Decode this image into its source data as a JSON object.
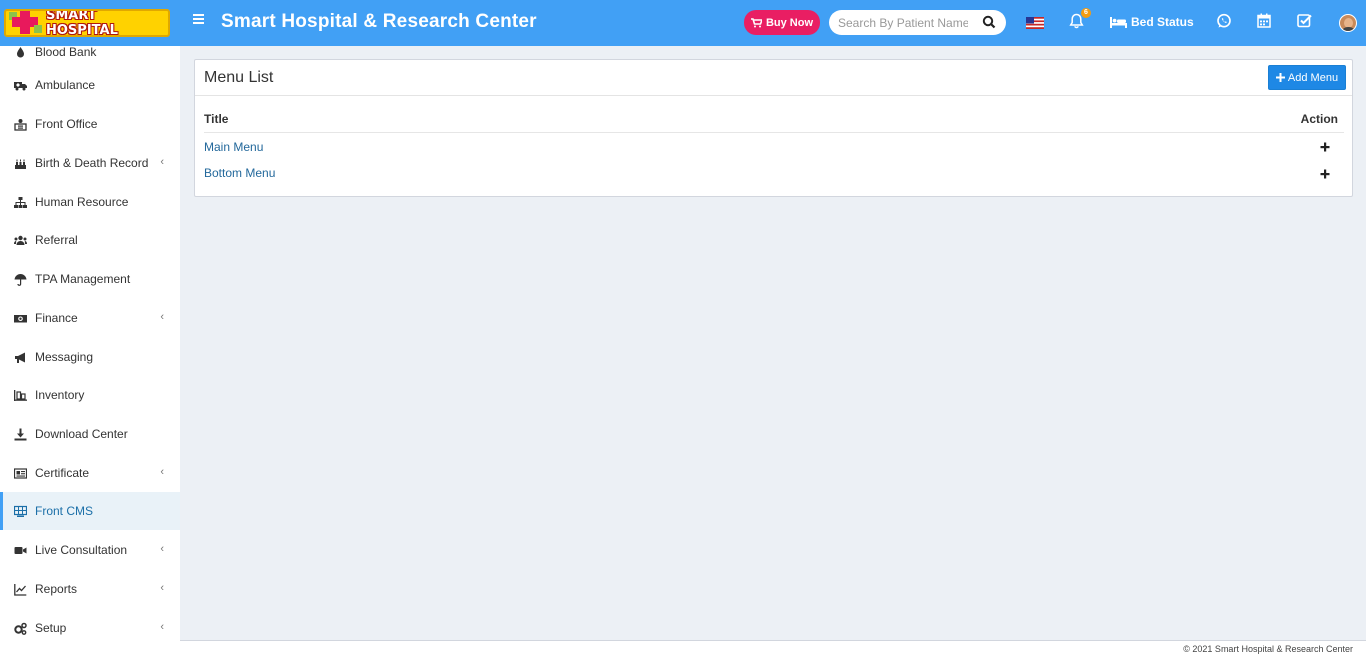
{
  "header": {
    "logo_text": "SMART HOSPITAL",
    "app_title": "Smart Hospital & Research Center",
    "buy_now_label": "Buy Now",
    "search_placeholder": "Search By Patient Name",
    "notification_count": "6",
    "bed_status_label": "Bed Status"
  },
  "sidebar": {
    "items": [
      {
        "label": "Blood Bank",
        "icon": "blood-drop-icon",
        "has_submenu": false
      },
      {
        "label": "Ambulance",
        "icon": "ambulance-icon",
        "has_submenu": false
      },
      {
        "label": "Front Office",
        "icon": "front-office-icon",
        "has_submenu": false
      },
      {
        "label": "Birth & Death Record",
        "icon": "birth-death-icon",
        "has_submenu": true
      },
      {
        "label": "Human Resource",
        "icon": "sitemap-icon",
        "has_submenu": false
      },
      {
        "label": "Referral",
        "icon": "users-icon",
        "has_submenu": false
      },
      {
        "label": "TPA Management",
        "icon": "umbrella-icon",
        "has_submenu": false
      },
      {
        "label": "Finance",
        "icon": "money-icon",
        "has_submenu": true
      },
      {
        "label": "Messaging",
        "icon": "bullhorn-icon",
        "has_submenu": false
      },
      {
        "label": "Inventory",
        "icon": "inventory-icon",
        "has_submenu": false
      },
      {
        "label": "Download Center",
        "icon": "download-icon",
        "has_submenu": false
      },
      {
        "label": "Certificate",
        "icon": "certificate-icon",
        "has_submenu": true
      },
      {
        "label": "Front CMS",
        "icon": "cms-icon",
        "has_submenu": false,
        "active": true
      },
      {
        "label": "Live Consultation",
        "icon": "video-icon",
        "has_submenu": true
      },
      {
        "label": "Reports",
        "icon": "line-chart-icon",
        "has_submenu": true
      },
      {
        "label": "Setup",
        "icon": "gears-icon",
        "has_submenu": true
      }
    ]
  },
  "main": {
    "box_title": "Menu List",
    "add_button_label": "Add Menu",
    "columns": {
      "title": "Title",
      "action": "Action"
    },
    "rows": [
      {
        "title": "Main Menu"
      },
      {
        "title": "Bottom Menu"
      }
    ]
  },
  "footer": {
    "copyright": "© 2021 Smart Hospital & Research Center"
  },
  "colors": {
    "header_bg": "#41a0f5",
    "buy_now_bg": "#e91e63",
    "add_button_bg": "#1e88e5",
    "link": "#23689b",
    "content_bg": "#ecf0f5"
  }
}
